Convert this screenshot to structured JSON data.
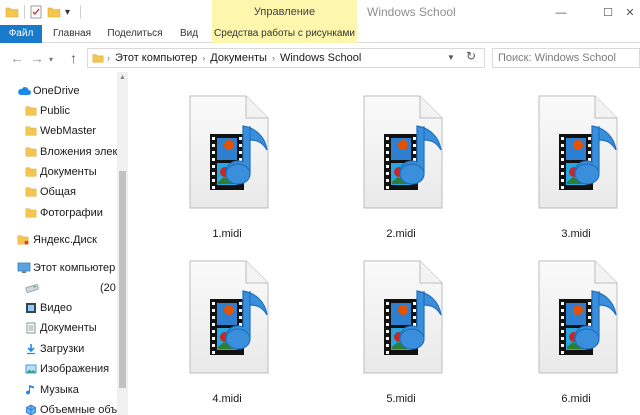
{
  "window": {
    "title": "Windows School",
    "context_group": "Управление",
    "minimize_glyph": "—",
    "maximize_glyph": "☐",
    "close_glyph": "✕"
  },
  "quick_access": {
    "dropdown_glyph": "▾"
  },
  "ribbon": {
    "tabs": [
      "Файл",
      "Главная",
      "Поделиться",
      "Вид",
      "Средства работы с рисунками"
    ]
  },
  "navigation": {
    "back_glyph": "←",
    "forward_glyph": "→",
    "up_glyph": "↑",
    "breadcrumbs": [
      "Этот компьютер",
      "Документы",
      "Windows School"
    ],
    "separator_glyph": "›",
    "search_placeholder": "Поиск: Windows School"
  },
  "sidebar": {
    "items": [
      {
        "label": "OneDrive",
        "icon": "cloud-icon"
      },
      {
        "label": "Public",
        "icon": "folder-icon"
      },
      {
        "label": "WebMaster",
        "icon": "folder-icon"
      },
      {
        "label": "Вложения электр",
        "icon": "folder-icon"
      },
      {
        "label": "Документы",
        "icon": "folder-icon"
      },
      {
        "label": "Общая",
        "icon": "folder-icon"
      },
      {
        "label": "Фотографии",
        "icon": "folder-icon"
      },
      {
        "label": "Яндекс.Диск",
        "icon": "yandex-disk-icon"
      },
      {
        "label": "Этот компьютер",
        "icon": "computer-icon"
      },
      {
        "label": "(20",
        "icon": "drive-icon"
      },
      {
        "label": "Видео",
        "icon": "video-icon"
      },
      {
        "label": "Документы",
        "icon": "documents-icon"
      },
      {
        "label": "Загрузки",
        "icon": "downloads-icon"
      },
      {
        "label": "Изображения",
        "icon": "pictures-icon"
      },
      {
        "label": "Музыка",
        "icon": "music-icon"
      },
      {
        "label": "Объемные объе",
        "icon": "3d-objects-icon"
      }
    ]
  },
  "files": [
    {
      "name": "1.midi",
      "icon": "midi-file-icon"
    },
    {
      "name": "2.midi",
      "icon": "midi-file-icon"
    },
    {
      "name": "3.midi",
      "icon": "midi-file-icon"
    },
    {
      "name": "4.midi",
      "icon": "midi-file-icon"
    },
    {
      "name": "5.midi",
      "icon": "midi-file-icon"
    },
    {
      "name": "6.midi",
      "icon": "midi-file-icon"
    }
  ],
  "colors": {
    "file_tab": "#1979ca",
    "context_tab": "#fdf6ad",
    "folder": "#f5c64f",
    "note": "#3a8fdc"
  }
}
